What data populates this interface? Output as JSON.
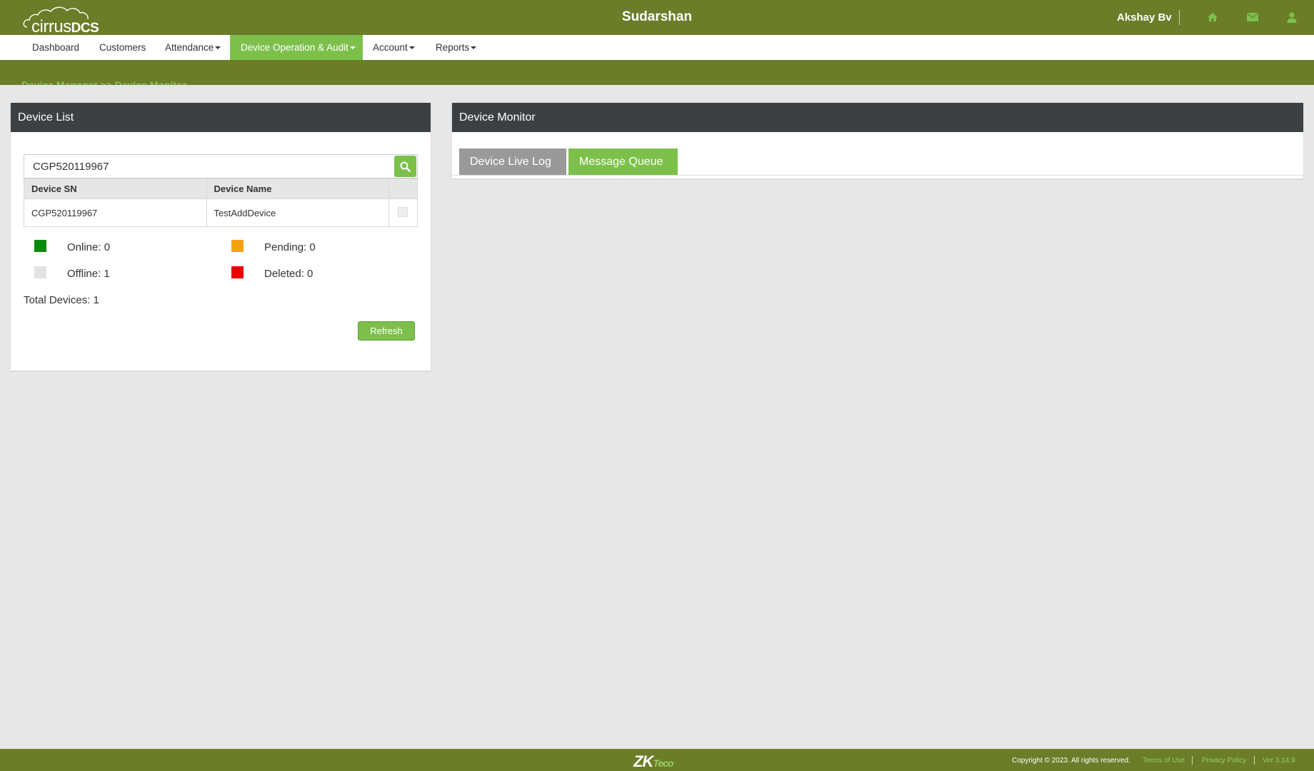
{
  "header": {
    "logo_text": "cirrus",
    "logo_bold": "DCS",
    "title": "Sudarshan",
    "user_name": "Akshay Bv",
    "icons": [
      "home-icon",
      "envelope-icon",
      "user-icon"
    ]
  },
  "nav": {
    "items": [
      {
        "label": "Dashboard",
        "dropdown": false
      },
      {
        "label": "Customers",
        "dropdown": false
      },
      {
        "label": "Attendance",
        "dropdown": true
      },
      {
        "label": "Device Operation & Audit",
        "dropdown": true,
        "active": true
      },
      {
        "label": "Account",
        "dropdown": true
      },
      {
        "label": "Reports",
        "dropdown": true
      }
    ]
  },
  "breadcrumb": "Device Manager >> Device Monitor",
  "device_list": {
    "title": "Device List",
    "search_value": "CGP520119967",
    "columns": [
      "Device SN",
      "Device Name",
      ""
    ],
    "rows": [
      {
        "sn": "CGP520119967",
        "name": "TestAddDevice",
        "checked": false
      }
    ],
    "legend": {
      "online": "Online: 0",
      "pending": "Pending: 0",
      "offline": "Offline: 1",
      "deleted": "Deleted: 0"
    },
    "total": "Total Devices: 1",
    "refresh_label": "Refresh"
  },
  "device_monitor": {
    "title": "Device Monitor",
    "tabs": [
      "Device Live Log",
      "Message Queue"
    ],
    "active_tab": 1
  },
  "footer": {
    "brand": "ZKTeco",
    "copyright": "Copyright © 2023. All rights reserved.",
    "links": [
      "Terms of Use",
      "Privacy Policy"
    ],
    "version": "Ver 3.14.9"
  },
  "colors": {
    "header_green": "#6b7d28",
    "accent_green": "#7cc04b",
    "panel_head": "#3d4043",
    "online": "#0a8a0a",
    "pending": "#f5a210",
    "offline": "#e2e2e2",
    "deleted": "#ee0000",
    "inactive_tab": "#999999"
  }
}
